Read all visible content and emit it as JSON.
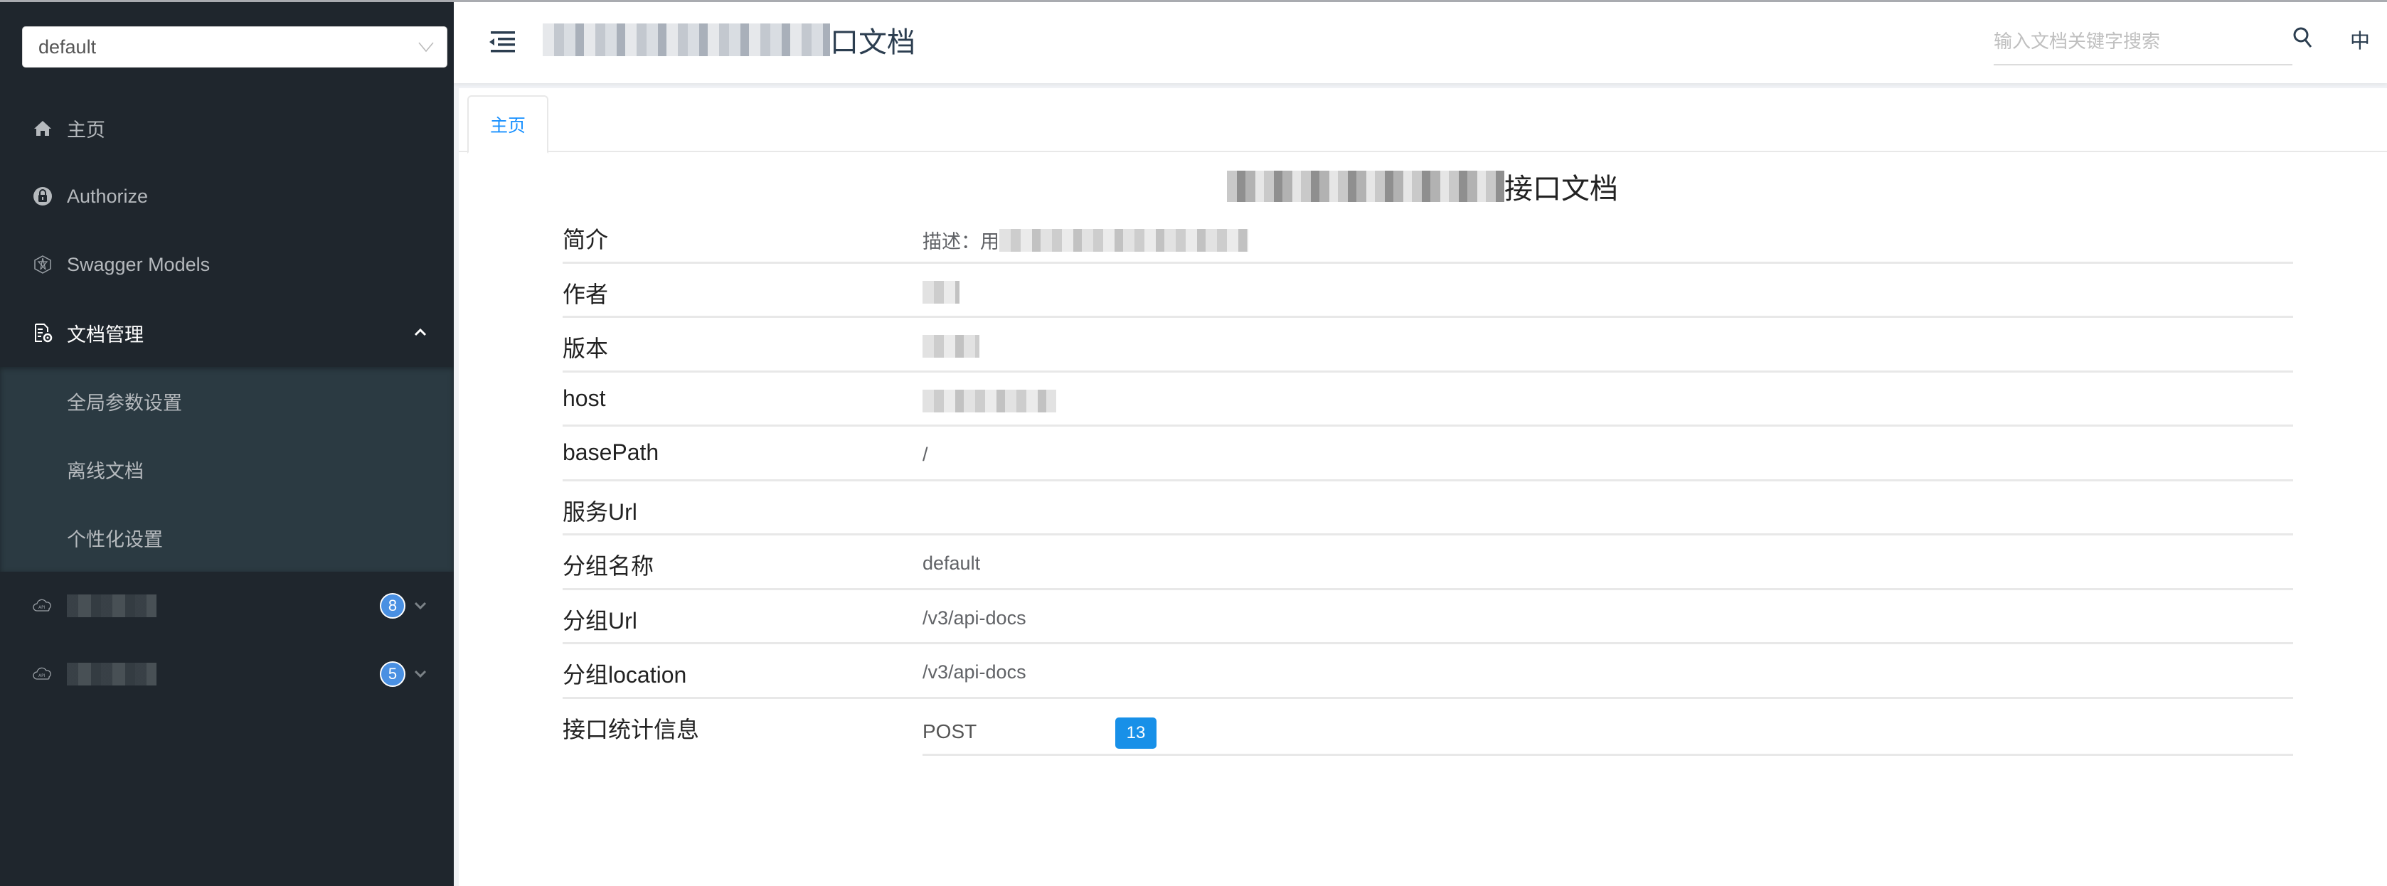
{
  "sidebar": {
    "group_select": {
      "value": "default"
    },
    "items": [
      {
        "label": "主页",
        "icon": "home-icon"
      },
      {
        "label": "Authorize",
        "icon": "lock-icon"
      },
      {
        "label": "Swagger Models",
        "icon": "models-icon"
      },
      {
        "label": "文档管理",
        "icon": "document-settings-icon",
        "expanded": true,
        "children": [
          {
            "label": "全局参数设置"
          },
          {
            "label": "离线文档"
          },
          {
            "label": "个性化设置"
          }
        ]
      }
    ],
    "api_groups": [
      {
        "label": "",
        "redacted": true,
        "count": "8",
        "icon": "api-cloud-icon"
      },
      {
        "label": "",
        "redacted": true,
        "count": "5",
        "icon": "api-cloud-icon"
      }
    ]
  },
  "header": {
    "title_visible_suffix": "口文档",
    "title_redacted": true,
    "search_placeholder": "输入文档关键字搜索",
    "search_value": "",
    "lang_label": "中"
  },
  "tabs": [
    {
      "label": "主页",
      "active": true
    }
  ],
  "doc": {
    "title_visible_suffix": "接口文档",
    "title_redacted": true,
    "rows": [
      {
        "key": "简介",
        "value": "描述：用",
        "value_redacted_suffix": true
      },
      {
        "key": "作者",
        "value": "",
        "redacted": true
      },
      {
        "key": "版本",
        "value": "",
        "redacted": true
      },
      {
        "key": "host",
        "value": "",
        "redacted": true
      },
      {
        "key": "basePath",
        "value": "/"
      },
      {
        "key": "服务Url",
        "value": ""
      },
      {
        "key": "分组名称",
        "value": "default"
      },
      {
        "key": "分组Url",
        "value": "/v3/api-docs"
      },
      {
        "key": "分组location",
        "value": "/v3/api-docs"
      },
      {
        "key": "接口统计信息",
        "stats": [
          {
            "method": "POST",
            "count": "13"
          }
        ]
      }
    ]
  },
  "colors": {
    "sidebar_bg": "#1f262d",
    "submenu_bg": "#2b3a42",
    "accent": "#1890ff",
    "badge_blue": "#4a90e2",
    "count_badge": "#1890e8"
  }
}
